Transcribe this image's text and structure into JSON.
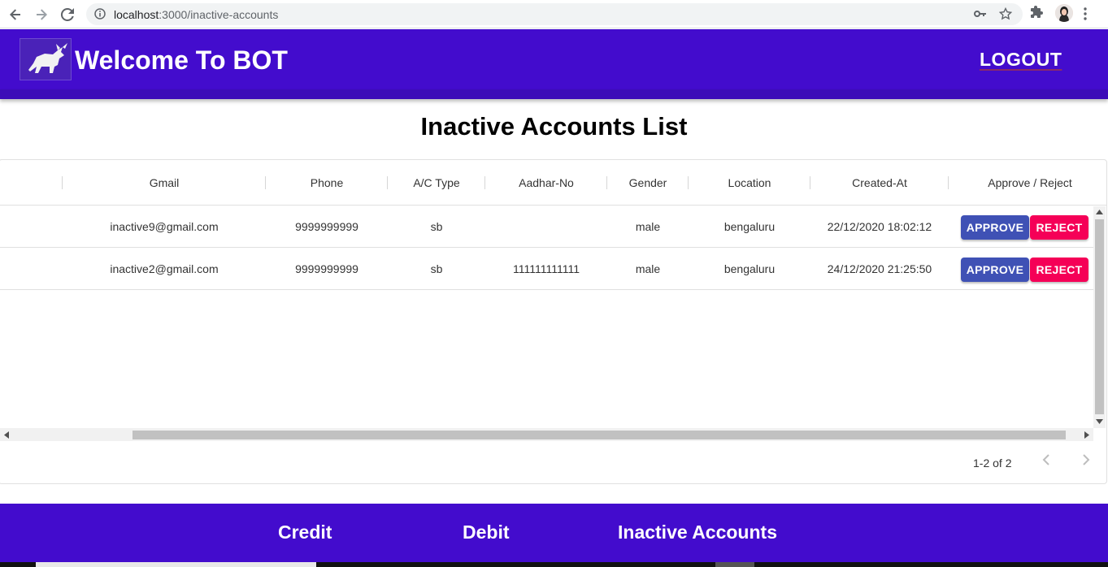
{
  "browser": {
    "url_host": "localhost",
    "url_rest": ":3000/inactive-accounts"
  },
  "header": {
    "title": "Welcome To BOT",
    "logout_label": "LOGOUT"
  },
  "page_title": "Inactive Accounts List",
  "table": {
    "columns": [
      "Gmail",
      "Phone",
      "A/C Type",
      "Aadhar-No",
      "Gender",
      "Location",
      "Created-At",
      "Approve / Reject"
    ],
    "rows": [
      {
        "gmail": "inactive9@gmail.com",
        "phone": "9999999999",
        "ac_type": "sb",
        "aadhar": "",
        "gender": "male",
        "location": "bengaluru",
        "created_at": "22/12/2020 18:02:12",
        "approve": "APPROVE",
        "reject": "REJECT"
      },
      {
        "gmail": "inactive2@gmail.com",
        "phone": "9999999999",
        "ac_type": "sb",
        "aadhar": "111111111111",
        "gender": "male",
        "location": "bengaluru",
        "created_at": "24/12/2020 21:25:50",
        "approve": "APPROVE",
        "reject": "REJECT"
      }
    ],
    "pagination": "1-2 of 2"
  },
  "footer": {
    "links": [
      "Credit",
      "Debit",
      "Inactive Accounts"
    ]
  },
  "colors": {
    "brand": "#430ccd",
    "approve": "#3f51b5",
    "reject": "#f50057"
  },
  "icons": [
    "back-icon",
    "forward-icon",
    "reload-icon",
    "info-icon",
    "key-icon",
    "star-icon",
    "extensions-icon",
    "profile-avatar",
    "more-icon",
    "bull-logo",
    "chevron-left-icon",
    "chevron-right-icon"
  ]
}
